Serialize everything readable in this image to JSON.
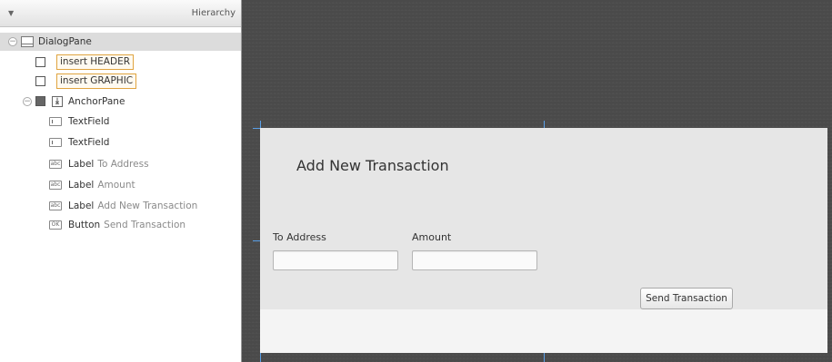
{
  "hierarchy": {
    "title": "Hierarchy",
    "root": "DialogPane",
    "insert_header": "insert HEADER",
    "insert_graphic": "insert GRAPHIC",
    "anchor_pane": "AnchorPane",
    "children": [
      {
        "type": "TextField",
        "label": "",
        "icon": "textfield-icon",
        "icon_glyph": ""
      },
      {
        "type": "TextField",
        "label": "",
        "icon": "textfield-icon",
        "icon_glyph": ""
      },
      {
        "type": "Label",
        "label": "To Address",
        "icon": "label-icon",
        "icon_glyph": "abc"
      },
      {
        "type": "Label",
        "label": "Amount",
        "icon": "label-icon",
        "icon_glyph": "abc"
      },
      {
        "type": "Label",
        "label": "Add New Transaction",
        "icon": "label-icon",
        "icon_glyph": "abc"
      },
      {
        "type": "Button",
        "label": "Send Transaction",
        "icon": "button-icon",
        "icon_glyph": "OK"
      }
    ]
  },
  "dialog": {
    "title": "Add New Transaction",
    "to_address_label": "To Address",
    "amount_label": "Amount",
    "to_address_value": "",
    "amount_value": "",
    "send_button": "Send Transaction"
  },
  "colors": {
    "canvas_bg": "#4a4a4a",
    "selection_bg": "#dcdcdc",
    "insert_border": "#e0a440",
    "guide_tick": "#5aa0e8"
  }
}
